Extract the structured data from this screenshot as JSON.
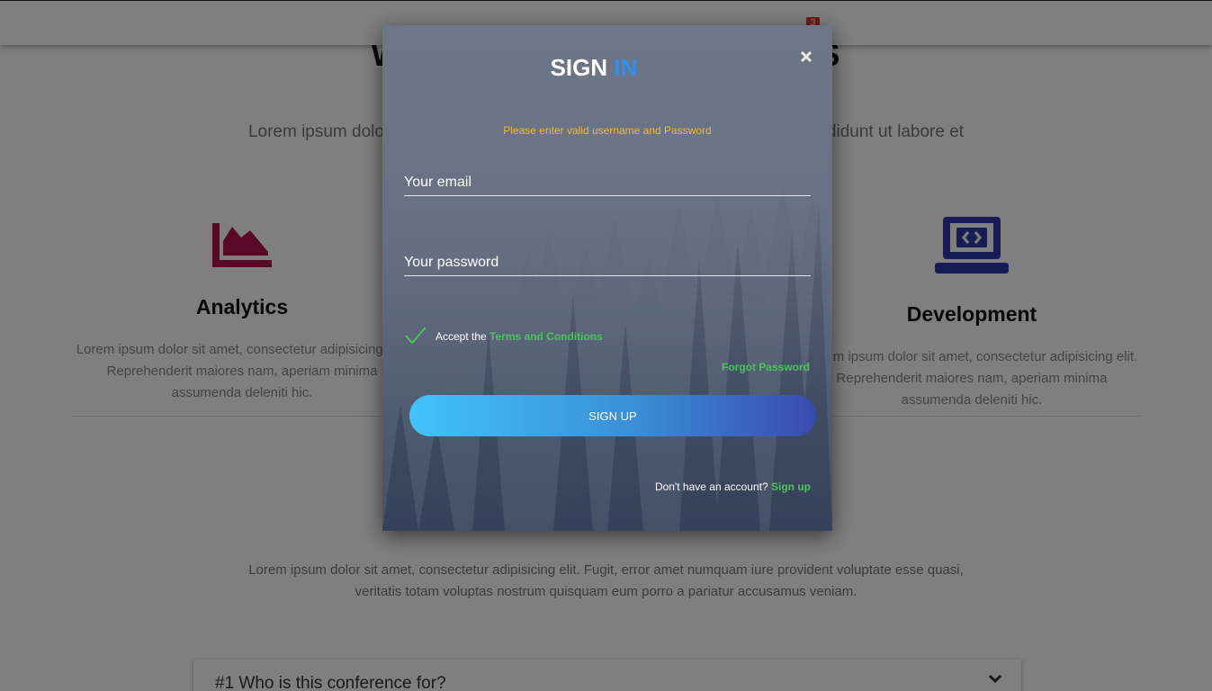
{
  "navbar": {
    "badge_count": "3"
  },
  "background": {
    "section_title": "W                                          S",
    "section_lead": "Lorem ipsum dolor sit                                                                                  incididunt ut labore et",
    "features": [
      {
        "icon": "area-chart-icon",
        "title": "Analytics",
        "text": "Lorem ipsum dolor sit amet, consectetur adipisicing elit. Reprehenderit maiores nam, aperiam minima assumenda deleniti hic."
      },
      {
        "icon": "laptop-code-icon",
        "title": "Development",
        "text": "Lorem ipsum dolor sit amet, consectetur adipisicing elit. Reprehenderit maiores nam, aperiam minima assumenda deleniti hic."
      }
    ],
    "bottom_text": "Lorem ipsum dolor sit amet, consectetur adipisicing elit. Fugit, error amet numquam iure provident voluptate esse quasi, veritatis totam voluptas nostrum quisquam eum porro a pariatur accusamus veniam.",
    "faq_first": "#1 Who is this conference for?"
  },
  "modal": {
    "title_part1": "SIGN",
    "title_part2": "IN",
    "error_message": "Please enter valid username and Password",
    "email_placeholder": "Your email",
    "password_placeholder": "Your password",
    "accept_prefix": "Accept the",
    "terms_link": "Terms and Conditions",
    "forgot_password": "Forgot Password",
    "signup_button": "SIGN UP",
    "account_prompt": "Don't have an account?",
    "signup_link": "Sign up"
  },
  "colors": {
    "accent_blue": "#2f8ff0",
    "link_green": "#4bc25b",
    "error_orange": "#f5b82e",
    "analytics_icon": "#b3134a",
    "development_icon": "#2b3aa8"
  }
}
